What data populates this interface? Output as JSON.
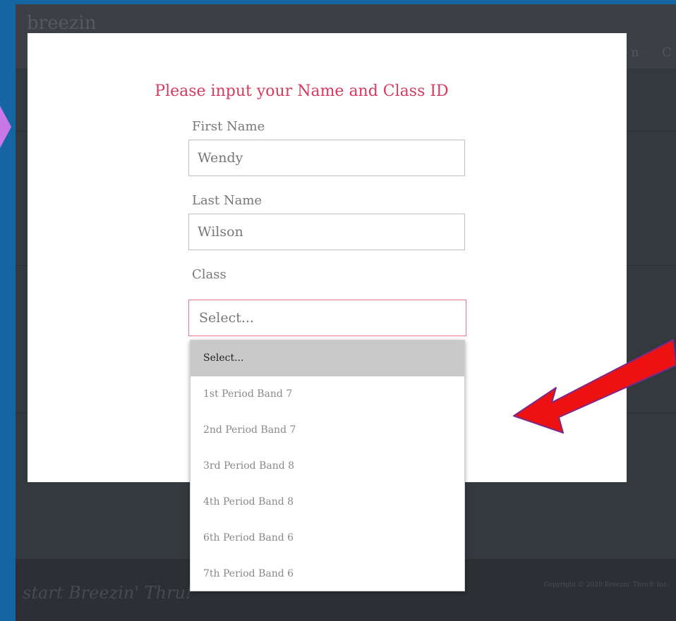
{
  "background": {
    "logo": "breezin",
    "nav_fragments": [
      "n",
      "C"
    ],
    "tagline": "start Breezin' Thru!",
    "copyright": "Copyright © 2020 Breezin' Thru® Inc."
  },
  "modal": {
    "title": "Please input your Name and Class ID",
    "first_name": {
      "label": "First Name",
      "value": "Wendy"
    },
    "last_name": {
      "label": "Last Name",
      "value": "Wilson"
    },
    "class": {
      "label": "Class",
      "value": "Select...",
      "options": [
        "Select...",
        "1st Period Band 7",
        "2nd Period Band 7",
        "3rd Period Band 8",
        "4th Period Band 8",
        "6th Period Band 6",
        "7th Period Band 6"
      ],
      "highlighted_index": 0
    }
  },
  "colors": {
    "slide_bg": "#1565a3",
    "title_accent": "#d63a5e",
    "arrow": "#ee1111",
    "callout": "#c878e6"
  }
}
